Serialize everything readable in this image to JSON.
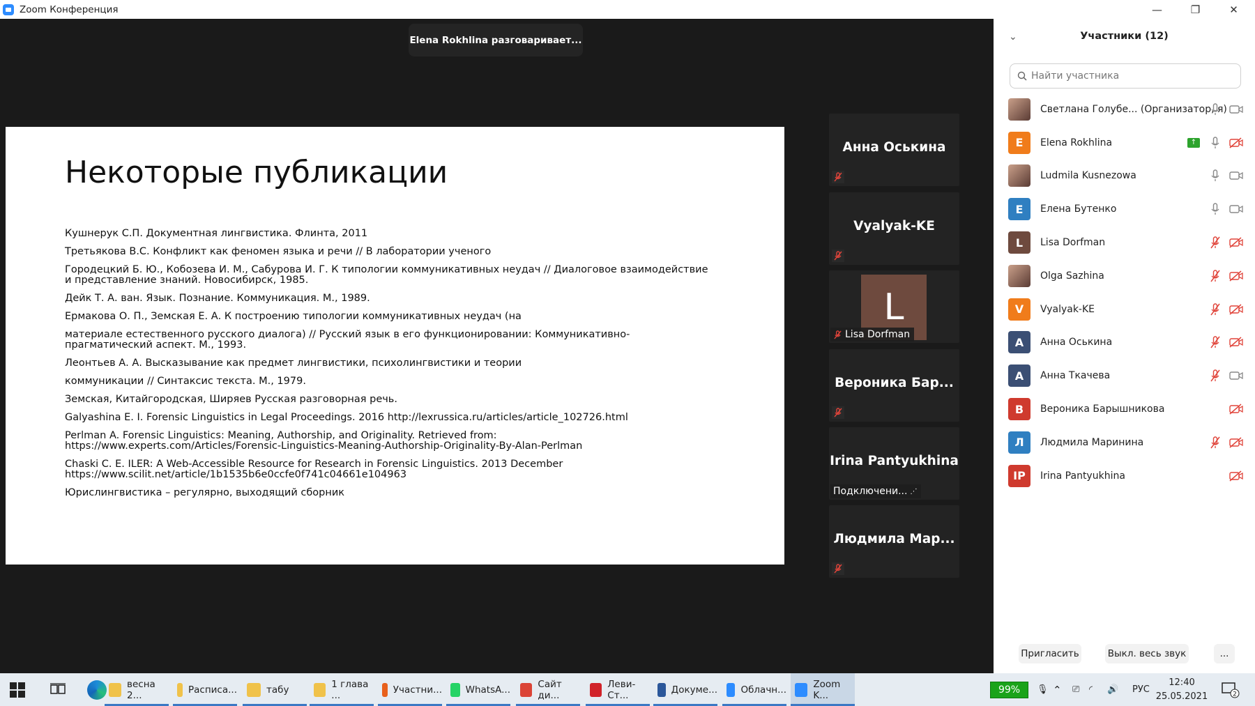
{
  "window": {
    "title": "Zoom Конференция",
    "controls": {
      "minimize": "—",
      "maximize": "❐",
      "close": "✕"
    }
  },
  "meeting": {
    "talking_indicator": "Elena Rokhlina разговаривает...",
    "slide": {
      "title": "Некоторые публикации",
      "references": [
        "Кушнерук С.П. Документная лингвистика. Флинта, 2011",
        "Третьякова В.С. Конфликт как феномен языка и речи // В лаборатории ученого",
        "Городецкий Б. Ю., Кобозева И. М., Сабурова И. Г. К типологии коммуникативных неудач // Диалоговое взаимодействие и представление знаний. Новосибирск, 1985.",
        "Дейк Т. А. ван. Язык. Познание. Коммуникация. М., 1989.",
        "Ермакова О. П., Земская Е. А. К построению типологии коммуникативных неудач (на",
        "материале естественного русского диалога) // Русский язык в его функционировании: Коммуникативно-прагматический аспект. М., 1993.",
        "Леонтьев А. А. Высказывание как предмет лингвистики, психолингвистики и теории",
        "коммуникации // Синтаксис текста. М., 1979.",
        "Земская, Китайгородская, Ширяев Русская разговорная речь.",
        "Galyashina E. I. Forensic Linguistics in Legal Proceedings. 2016 http://lexrussica.ru/articles/article_102726.html",
        "Perlman A. Forensic Linguistics: Meaning, Authorship, and Originality. Retrieved from: https://www.experts.com/Articles/Forensic-Linguistics-Meaning-Authorship-Originality-By-Alan-Perlman",
        "Chaski C. E. ILER: A Web-Accessible Resource for Research in Forensic Linguistics. 2013 December https://www.scilit.net/article/1b1535b6e0ccfe0f741c04661e104963",
        "Юрислингвистика – регулярно, выходящий сборник"
      ]
    },
    "gallery": [
      {
        "name": "Анна Оськина",
        "muted": true
      },
      {
        "name": "Vyalyak-KE",
        "muted": true
      },
      {
        "name": "Lisa Dorfman",
        "avatar_letter": "L",
        "muted": true
      },
      {
        "name": "Вероника Бар...",
        "muted": true
      },
      {
        "name": "Irina Pantyukhina",
        "status": "Подключени..."
      },
      {
        "name": "Людмила Мар...",
        "muted": true
      }
    ]
  },
  "participants": {
    "title": "Участники (12)",
    "search_placeholder": "Найти участника",
    "list": [
      {
        "name": "Светлана Голубе... (Организатор, я)",
        "avatar": "photo",
        "mic": "on",
        "cam": "on"
      },
      {
        "name": "Elena Rokhlina",
        "avatar_letter": "E",
        "color": "#f07c1b",
        "share": true,
        "mic": "on",
        "cam": "off"
      },
      {
        "name": "Ludmila Kusnezowa",
        "avatar": "photo",
        "mic": "on",
        "cam": "on"
      },
      {
        "name": "Елена Бутенко",
        "avatar_letter": "E",
        "color": "#2f7fc1",
        "mic": "on",
        "cam": "on"
      },
      {
        "name": "Lisa Dorfman",
        "avatar_letter": "L",
        "color": "#6e4a3e",
        "mic": "off",
        "cam": "off"
      },
      {
        "name": "Olga Sazhina",
        "avatar": "photo",
        "mic": "off",
        "cam": "off"
      },
      {
        "name": "Vyalyak-KE",
        "avatar_letter": "V",
        "color": "#f07c1b",
        "mic": "off",
        "cam": "off"
      },
      {
        "name": "Анна Оськина",
        "avatar_letter": "А",
        "color": "#3b4f74",
        "mic": "off",
        "cam": "off"
      },
      {
        "name": "Анна Ткачева",
        "avatar_letter": "А",
        "color": "#3b4f74",
        "mic": "off",
        "cam": "on"
      },
      {
        "name": "Вероника Барышникова",
        "avatar_letter": "В",
        "color": "#cf3a2e",
        "mic": "none",
        "cam": "off"
      },
      {
        "name": "Людмила Маринина",
        "avatar_letter": "Л",
        "color": "#2f7fc1",
        "mic": "off",
        "cam": "off"
      },
      {
        "name": "Irina Pantyukhina",
        "avatar_letter": "IP",
        "color": "#cf3a2e",
        "mic": "none",
        "cam": "off"
      }
    ],
    "buttons": {
      "invite": "Пригласить",
      "mute_all": "Выкл. весь звук",
      "more": "..."
    }
  },
  "taskbar": {
    "apps": [
      {
        "label": "весна 2...",
        "icon_color": "#f0c24a"
      },
      {
        "label": "Расписа...",
        "icon_color": "#f0c24a"
      },
      {
        "label": "табу",
        "icon_color": "#f0c24a"
      },
      {
        "label": "1 глава ...",
        "icon_color": "#f0c24a"
      },
      {
        "label": "Участни...",
        "icon_color": "#e8601c"
      },
      {
        "label": "WhatsA...",
        "icon_color": "#25d366"
      },
      {
        "label": "Сайт ди...",
        "icon_color": "#db4437"
      },
      {
        "label": "Леви-Ст...",
        "icon_color": "#d1232a"
      },
      {
        "label": "Докуме...",
        "icon_color": "#2b579a"
      },
      {
        "label": "Облачн...",
        "icon_color": "#2d8cff"
      },
      {
        "label": "Zoom K...",
        "icon_color": "#2d8cff"
      }
    ],
    "battery": "99%",
    "language": "РУС",
    "time": "12:40",
    "date": "25.05.2021",
    "notifications": "2"
  }
}
